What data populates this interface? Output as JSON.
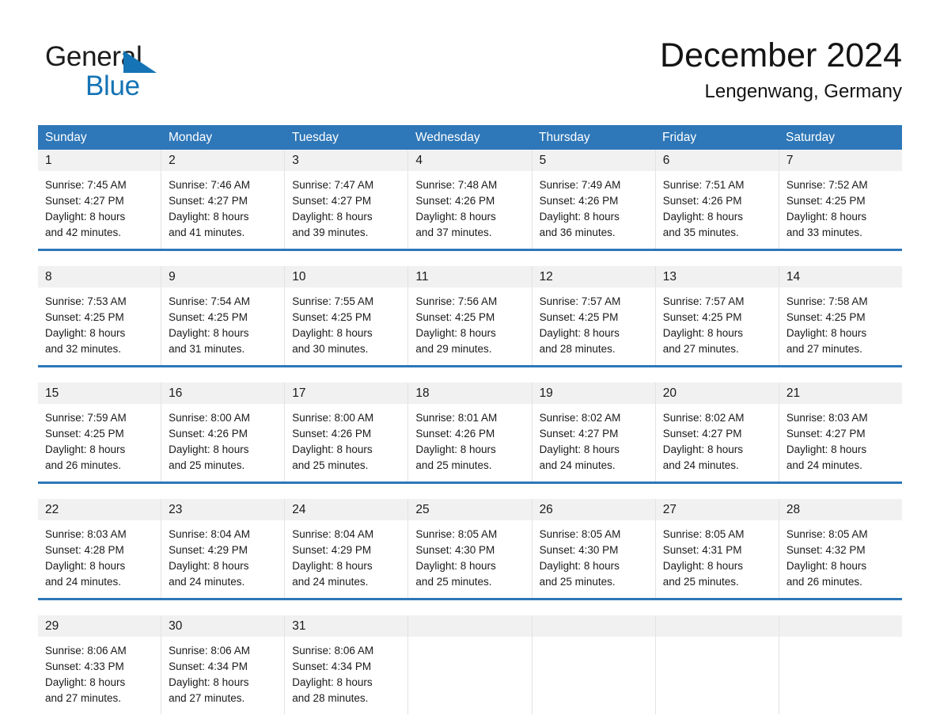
{
  "brand": {
    "name_part1": "General",
    "name_part2": "Blue",
    "accent_color": "#1574b5"
  },
  "header": {
    "title": "December 2024",
    "subtitle": "Lengenwang, Germany"
  },
  "calendar": {
    "header_bg": "#2e77b8",
    "daynum_bg": "#f1f1f1",
    "weekdays": [
      "Sunday",
      "Monday",
      "Tuesday",
      "Wednesday",
      "Thursday",
      "Friday",
      "Saturday"
    ],
    "weeks": [
      [
        {
          "day": "1",
          "sunrise": "Sunrise: 7:45 AM",
          "sunset": "Sunset: 4:27 PM",
          "daylight_line1": "Daylight: 8 hours",
          "daylight_line2": "and 42 minutes."
        },
        {
          "day": "2",
          "sunrise": "Sunrise: 7:46 AM",
          "sunset": "Sunset: 4:27 PM",
          "daylight_line1": "Daylight: 8 hours",
          "daylight_line2": "and 41 minutes."
        },
        {
          "day": "3",
          "sunrise": "Sunrise: 7:47 AM",
          "sunset": "Sunset: 4:27 PM",
          "daylight_line1": "Daylight: 8 hours",
          "daylight_line2": "and 39 minutes."
        },
        {
          "day": "4",
          "sunrise": "Sunrise: 7:48 AM",
          "sunset": "Sunset: 4:26 PM",
          "daylight_line1": "Daylight: 8 hours",
          "daylight_line2": "and 37 minutes."
        },
        {
          "day": "5",
          "sunrise": "Sunrise: 7:49 AM",
          "sunset": "Sunset: 4:26 PM",
          "daylight_line1": "Daylight: 8 hours",
          "daylight_line2": "and 36 minutes."
        },
        {
          "day": "6",
          "sunrise": "Sunrise: 7:51 AM",
          "sunset": "Sunset: 4:26 PM",
          "daylight_line1": "Daylight: 8 hours",
          "daylight_line2": "and 35 minutes."
        },
        {
          "day": "7",
          "sunrise": "Sunrise: 7:52 AM",
          "sunset": "Sunset: 4:25 PM",
          "daylight_line1": "Daylight: 8 hours",
          "daylight_line2": "and 33 minutes."
        }
      ],
      [
        {
          "day": "8",
          "sunrise": "Sunrise: 7:53 AM",
          "sunset": "Sunset: 4:25 PM",
          "daylight_line1": "Daylight: 8 hours",
          "daylight_line2": "and 32 minutes."
        },
        {
          "day": "9",
          "sunrise": "Sunrise: 7:54 AM",
          "sunset": "Sunset: 4:25 PM",
          "daylight_line1": "Daylight: 8 hours",
          "daylight_line2": "and 31 minutes."
        },
        {
          "day": "10",
          "sunrise": "Sunrise: 7:55 AM",
          "sunset": "Sunset: 4:25 PM",
          "daylight_line1": "Daylight: 8 hours",
          "daylight_line2": "and 30 minutes."
        },
        {
          "day": "11",
          "sunrise": "Sunrise: 7:56 AM",
          "sunset": "Sunset: 4:25 PM",
          "daylight_line1": "Daylight: 8 hours",
          "daylight_line2": "and 29 minutes."
        },
        {
          "day": "12",
          "sunrise": "Sunrise: 7:57 AM",
          "sunset": "Sunset: 4:25 PM",
          "daylight_line1": "Daylight: 8 hours",
          "daylight_line2": "and 28 minutes."
        },
        {
          "day": "13",
          "sunrise": "Sunrise: 7:57 AM",
          "sunset": "Sunset: 4:25 PM",
          "daylight_line1": "Daylight: 8 hours",
          "daylight_line2": "and 27 minutes."
        },
        {
          "day": "14",
          "sunrise": "Sunrise: 7:58 AM",
          "sunset": "Sunset: 4:25 PM",
          "daylight_line1": "Daylight: 8 hours",
          "daylight_line2": "and 27 minutes."
        }
      ],
      [
        {
          "day": "15",
          "sunrise": "Sunrise: 7:59 AM",
          "sunset": "Sunset: 4:25 PM",
          "daylight_line1": "Daylight: 8 hours",
          "daylight_line2": "and 26 minutes."
        },
        {
          "day": "16",
          "sunrise": "Sunrise: 8:00 AM",
          "sunset": "Sunset: 4:26 PM",
          "daylight_line1": "Daylight: 8 hours",
          "daylight_line2": "and 25 minutes."
        },
        {
          "day": "17",
          "sunrise": "Sunrise: 8:00 AM",
          "sunset": "Sunset: 4:26 PM",
          "daylight_line1": "Daylight: 8 hours",
          "daylight_line2": "and 25 minutes."
        },
        {
          "day": "18",
          "sunrise": "Sunrise: 8:01 AM",
          "sunset": "Sunset: 4:26 PM",
          "daylight_line1": "Daylight: 8 hours",
          "daylight_line2": "and 25 minutes."
        },
        {
          "day": "19",
          "sunrise": "Sunrise: 8:02 AM",
          "sunset": "Sunset: 4:27 PM",
          "daylight_line1": "Daylight: 8 hours",
          "daylight_line2": "and 24 minutes."
        },
        {
          "day": "20",
          "sunrise": "Sunrise: 8:02 AM",
          "sunset": "Sunset: 4:27 PM",
          "daylight_line1": "Daylight: 8 hours",
          "daylight_line2": "and 24 minutes."
        },
        {
          "day": "21",
          "sunrise": "Sunrise: 8:03 AM",
          "sunset": "Sunset: 4:27 PM",
          "daylight_line1": "Daylight: 8 hours",
          "daylight_line2": "and 24 minutes."
        }
      ],
      [
        {
          "day": "22",
          "sunrise": "Sunrise: 8:03 AM",
          "sunset": "Sunset: 4:28 PM",
          "daylight_line1": "Daylight: 8 hours",
          "daylight_line2": "and 24 minutes."
        },
        {
          "day": "23",
          "sunrise": "Sunrise: 8:04 AM",
          "sunset": "Sunset: 4:29 PM",
          "daylight_line1": "Daylight: 8 hours",
          "daylight_line2": "and 24 minutes."
        },
        {
          "day": "24",
          "sunrise": "Sunrise: 8:04 AM",
          "sunset": "Sunset: 4:29 PM",
          "daylight_line1": "Daylight: 8 hours",
          "daylight_line2": "and 24 minutes."
        },
        {
          "day": "25",
          "sunrise": "Sunrise: 8:05 AM",
          "sunset": "Sunset: 4:30 PM",
          "daylight_line1": "Daylight: 8 hours",
          "daylight_line2": "and 25 minutes."
        },
        {
          "day": "26",
          "sunrise": "Sunrise: 8:05 AM",
          "sunset": "Sunset: 4:30 PM",
          "daylight_line1": "Daylight: 8 hours",
          "daylight_line2": "and 25 minutes."
        },
        {
          "day": "27",
          "sunrise": "Sunrise: 8:05 AM",
          "sunset": "Sunset: 4:31 PM",
          "daylight_line1": "Daylight: 8 hours",
          "daylight_line2": "and 25 minutes."
        },
        {
          "day": "28",
          "sunrise": "Sunrise: 8:05 AM",
          "sunset": "Sunset: 4:32 PM",
          "daylight_line1": "Daylight: 8 hours",
          "daylight_line2": "and 26 minutes."
        }
      ],
      [
        {
          "day": "29",
          "sunrise": "Sunrise: 8:06 AM",
          "sunset": "Sunset: 4:33 PM",
          "daylight_line1": "Daylight: 8 hours",
          "daylight_line2": "and 27 minutes."
        },
        {
          "day": "30",
          "sunrise": "Sunrise: 8:06 AM",
          "sunset": "Sunset: 4:34 PM",
          "daylight_line1": "Daylight: 8 hours",
          "daylight_line2": "and 27 minutes."
        },
        {
          "day": "31",
          "sunrise": "Sunrise: 8:06 AM",
          "sunset": "Sunset: 4:34 PM",
          "daylight_line1": "Daylight: 8 hours",
          "daylight_line2": "and 28 minutes."
        },
        {
          "day": "",
          "sunrise": "",
          "sunset": "",
          "daylight_line1": "",
          "daylight_line2": ""
        },
        {
          "day": "",
          "sunrise": "",
          "sunset": "",
          "daylight_line1": "",
          "daylight_line2": ""
        },
        {
          "day": "",
          "sunrise": "",
          "sunset": "",
          "daylight_line1": "",
          "daylight_line2": ""
        },
        {
          "day": "",
          "sunrise": "",
          "sunset": "",
          "daylight_line1": "",
          "daylight_line2": ""
        }
      ]
    ]
  }
}
